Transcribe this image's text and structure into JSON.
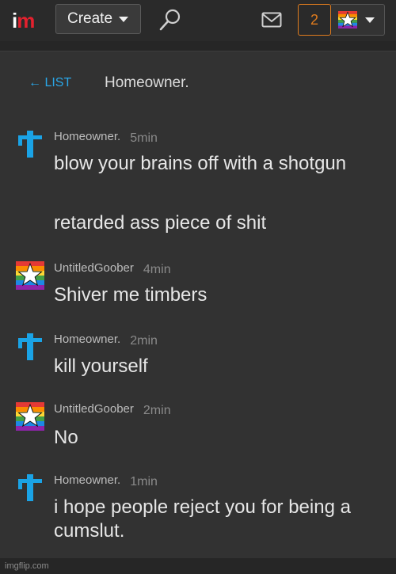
{
  "header": {
    "logo_i": "i",
    "logo_m": "m",
    "create_label": "Create",
    "notification_count": "2"
  },
  "thread": {
    "back_label": "← LIST",
    "title": "Homeowner."
  },
  "messages": [
    {
      "user": "Homeowner.",
      "time": "5min",
      "lines": [
        "blow your brains off with a shotgun",
        "retarded ass piece of shit"
      ]
    },
    {
      "user": "UntitledGoober",
      "time": "4min",
      "lines": [
        "Shiver me timbers"
      ]
    },
    {
      "user": "Homeowner.",
      "time": "2min",
      "lines": [
        "kill yourself"
      ]
    },
    {
      "user": "UntitledGoober",
      "time": "2min",
      "lines": [
        "No"
      ]
    },
    {
      "user": "Homeowner.",
      "time": "1min",
      "lines": [
        "i hope people reject you for being a cumslut."
      ]
    }
  ],
  "watermark": "imgflip.com",
  "colors": {
    "accent_blue": "#2aa7e8",
    "logo_red": "#e3212e",
    "badge_orange": "#e07c1e"
  },
  "icons": {
    "search": "search-icon",
    "mail": "mail-icon",
    "homeowner_avatar": "cross-avatar-icon",
    "goober_avatar": "rainbow-star-avatar-icon"
  }
}
